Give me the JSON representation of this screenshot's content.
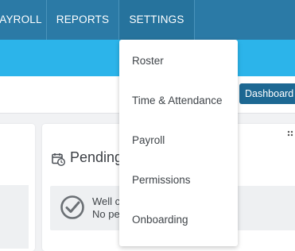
{
  "nav": {
    "items": [
      {
        "label": "AYROLL"
      },
      {
        "label": "REPORTS"
      },
      {
        "label": "SETTINGS"
      }
    ]
  },
  "toolbar": {
    "dashboard_label": "Dashboard"
  },
  "settings_menu": {
    "items": [
      {
        "label": "Roster"
      },
      {
        "label": "Time & Attendance"
      },
      {
        "label": "Payroll"
      },
      {
        "label": "Permissions"
      },
      {
        "label": "Onboarding"
      }
    ]
  },
  "pending_card": {
    "title": "Pending",
    "notice_line1": "Well c",
    "notice_line2": "No pe"
  },
  "icons": {
    "calendar": "calendar-clock-icon",
    "check": "check-circle-icon",
    "drag": "drag-handle-icon"
  },
  "colors": {
    "nav_bg": "#2b7aa6",
    "subbar_bg": "#2cb4ea",
    "dashboard_button": "#1d6893"
  }
}
